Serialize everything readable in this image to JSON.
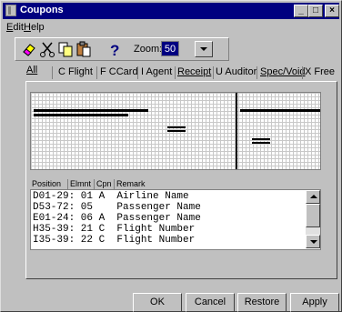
{
  "window": {
    "title": "Coupons",
    "minimize": "_",
    "maximize": "□",
    "close": "×"
  },
  "menu": [
    {
      "label": "Edit",
      "u": "E",
      "rest": "dit"
    },
    {
      "label": "Help",
      "u": "H",
      "rest": "elp"
    }
  ],
  "toolbar": {
    "zoom_label": "Zoom:",
    "zoom_value": "50",
    "icons": [
      "eraser-icon",
      "cut-icon",
      "copy-icon",
      "paste-icon",
      "help-icon"
    ]
  },
  "tabs": [
    {
      "label": "All",
      "selected": true
    },
    {
      "label": "C Flight"
    },
    {
      "label": "F CCard"
    },
    {
      "label": "I Agent"
    },
    {
      "label": "Receipt"
    },
    {
      "label": "U Auditor"
    },
    {
      "label": "Spec/Void"
    },
    {
      "label": "X Free"
    }
  ],
  "list": {
    "columns": [
      "Position",
      "Elmnt",
      "Cpn",
      "Remark"
    ],
    "rows": [
      "D01-29: 01 A  Airline Name",
      "D53-72: 05    Passenger Name",
      "E01-24: 06 A  Passenger Name",
      "H35-39: 21 C  Flight Number",
      "I35-39: 22 C  Flight Number"
    ]
  },
  "buttons": {
    "ok": "OK",
    "cancel": "Cancel",
    "restore": "Restore",
    "apply": "Apply"
  }
}
